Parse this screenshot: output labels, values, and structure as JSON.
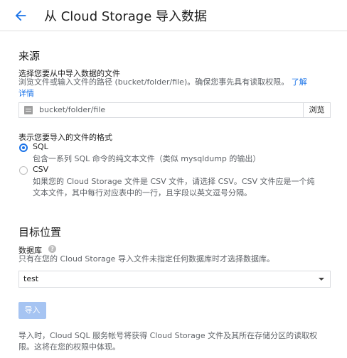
{
  "header": {
    "title": "从 Cloud Storage 导入数据"
  },
  "source": {
    "section_title": "来源",
    "file_label": "选择您要从中导入数据的文件",
    "file_help_line1": "浏览文件或输入文件的路径 (bucket/folder/file)。确保您事先具有读取权限。",
    "learn_more_part1": "了解",
    "learn_more_part2": "详情",
    "path_placeholder": "bucket/folder/file",
    "browse_label": "浏览",
    "format_label": "表示您要导入的文件的格式",
    "formats": [
      {
        "label": "SQL",
        "description": "包含一系列 SQL 命令的纯文本文件（类似 mysqldump 的输出）",
        "selected": true
      },
      {
        "label": "CSV",
        "description_line1": "如果您的 Cloud Storage 文件是 CSV 文件，请选择 CSV。CSV 文件应是一个纯",
        "description_line2": "文本文件，其中每行对应表中的一行，且字段以英文逗号分隔。",
        "selected": false
      }
    ]
  },
  "destination": {
    "section_title": "目标位置",
    "database_label": "数据库",
    "help_icon_glyph": "?",
    "database_help": "只有在您的 Cloud Storage 导入文件未指定任何数据库时才选择数据库。",
    "database_value": "test"
  },
  "import_button": "导入",
  "footer": {
    "note_line1": "导入时，Cloud SQL 服务帐号将获得 Cloud Storage 文件及其所在存储分区的读取权",
    "note_line2": "限。这将在您的权限中体现。"
  },
  "colors": {
    "accent": "#1a73e8",
    "disabled_button": "#a6c4f2",
    "muted_text": "#5f6368"
  },
  "icons": {
    "back": "arrow-back-icon",
    "file": "file-icon",
    "help": "help-icon",
    "dropdown": "dropdown-arrow-icon"
  }
}
